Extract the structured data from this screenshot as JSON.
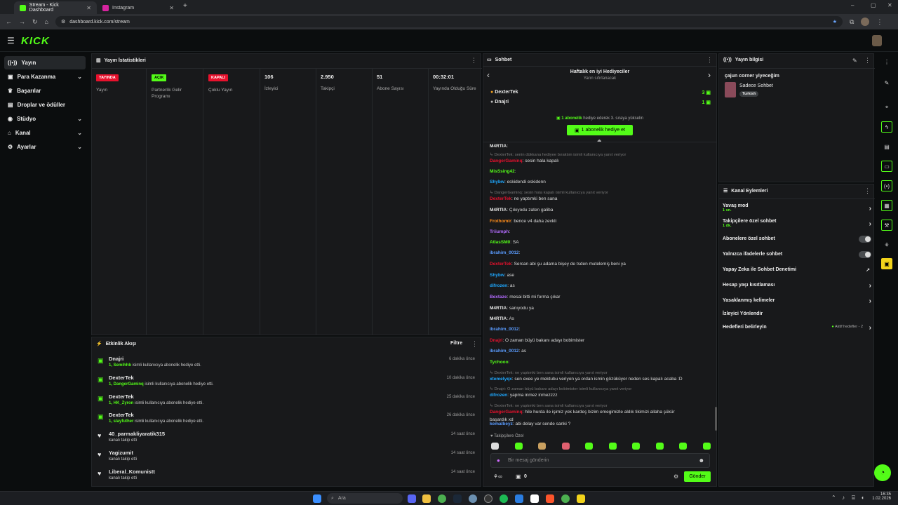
{
  "browser": {
    "tabs": [
      {
        "title": "Stream - Kick Dashboard",
        "active": true
      },
      {
        "title": "Instagram",
        "active": false
      }
    ],
    "url": "dashboard.kick.com/stream"
  },
  "brand": {
    "logo": "KICK",
    "accent": "#53fc18"
  },
  "sidebar": {
    "items": [
      {
        "label": "Yayın",
        "icon": "broadcast-icon",
        "active": true
      },
      {
        "label": "Para Kazanma",
        "icon": "money-icon",
        "expandable": true
      },
      {
        "label": "Başarılar",
        "icon": "trophy-icon"
      },
      {
        "label": "Droplar ve ödüller",
        "icon": "gift-icon"
      },
      {
        "label": "Stüdyo",
        "icon": "studio-icon",
        "expandable": true
      },
      {
        "label": "Kanal",
        "icon": "channel-icon",
        "expandable": true
      },
      {
        "label": "Ayarlar",
        "icon": "gear-icon",
        "expandable": true
      }
    ]
  },
  "stats": {
    "title": "Yayın İstatistikleri",
    "columns": [
      {
        "badge": "YAYINDA",
        "badge_color": "#e8112d",
        "label": "Yayın"
      },
      {
        "badge": "AÇIK",
        "badge_color": "#53fc18",
        "label": "Partnerlik Gelir Programı"
      },
      {
        "badge": "KAPALI",
        "badge_color": "#e8112d",
        "label": "Çoklu Yayın"
      },
      {
        "value": "106",
        "label": "İzleyici"
      },
      {
        "value": "2.950",
        "label": "Takipçi"
      },
      {
        "value": "51",
        "label": "Abone Sayısı"
      },
      {
        "value": "00:32:01",
        "label": "Yayında Olduğu Süre"
      }
    ]
  },
  "events": {
    "title": "Etkinlik Akışı",
    "filter_label": "Filtre",
    "items": [
      {
        "name": "Dnajri",
        "sub_user": "1, Semihhb",
        "sub_text": " isimli kullanıcıya abonelik hediye etti.",
        "time": "6 dakika önce",
        "kind": "gift"
      },
      {
        "name": "DexterTek",
        "sub_user": "1, DangerGaminq",
        "sub_text": " isimli kullanıcıya abonelik hediye etti.",
        "time": "10 dakika önce",
        "kind": "gift"
      },
      {
        "name": "DexterTek",
        "sub_user": "1, HK_Zyron",
        "sub_text": " isimli kullanıcıya abonelik hediye etti.",
        "time": "25 dakika önce",
        "kind": "gift"
      },
      {
        "name": "DexterTek",
        "sub_user": "1, slayfuther",
        "sub_text": " isimli kullanıcıya abonelik hediye etti.",
        "time": "26 dakika önce",
        "kind": "gift"
      },
      {
        "name": "40_parmakliyaratik315",
        "sub_user": "",
        "sub_text": "kanalı takip etti",
        "time": "14 saat önce",
        "kind": "follow"
      },
      {
        "name": "Yagizumit",
        "sub_user": "",
        "sub_text": "kanalı takip etti",
        "time": "14 saat önce",
        "kind": "follow"
      },
      {
        "name": "Liberal_Komunistt",
        "sub_user": "",
        "sub_text": "kanalı takip etti",
        "time": "14 saat önce",
        "kind": "follow"
      }
    ]
  },
  "chat": {
    "title": "Sohbet",
    "gifters_title": "Haftalık en iyi Hediyeciler",
    "gifters_sub": "Yarın sıfırlanacak",
    "gifters": [
      {
        "rank": "1",
        "name": "DexterTek",
        "count": "3"
      },
      {
        "rank": "2",
        "name": "Dnajri",
        "count": "1"
      }
    ],
    "promo_bold": "1 abonelik",
    "promo_text": " hediye ederek 3. sıraya yükselin",
    "promo_button": "1 abonelik hediye et",
    "messages": [
      {
        "reply": "",
        "user": "M4RTIA",
        "color": "#e8e8e8",
        "text": ":"
      },
      {
        "reply": "↳ DexterTek: senin dükkana hediyee bıraktım isimli kullanıcıya yanıt veriyor",
        "user": "",
        "color": "",
        "text": ""
      },
      {
        "reply": "",
        "user": "DangerGaminq",
        "color": "#e8112d",
        "text": ": sesin hala kapalı"
      },
      {
        "reply": "",
        "user": "MisSsing42",
        "color": "#53fc18",
        "text": ":"
      },
      {
        "reply": "",
        "user": "Shybw",
        "color": "#1ea8ff",
        "text": ": eskidendi eskidenn"
      },
      {
        "reply": "↳ DangerGaminq: sesin hala kapalı isimli kullanıcıya yanıt veriyor",
        "user": "",
        "color": "",
        "text": ""
      },
      {
        "reply": "",
        "user": "DexterTek",
        "color": "#e8112d",
        "text": ": ne yaptımki ben sana"
      },
      {
        "reply": "",
        "user": "M4RTIA",
        "color": "#e8e8e8",
        "text": ": Çıkıyodu zaten galiba"
      },
      {
        "reply": "",
        "user": "Frothomir",
        "color": "#ff8c1a",
        "text": ": bence v4 daha zevkli"
      },
      {
        "reply": "",
        "user": "Triiumph",
        "color": "#b36bff",
        "text": ":"
      },
      {
        "reply": "",
        "user": "AtlasSM0",
        "color": "#53fc18",
        "text": ": SA"
      },
      {
        "reply": "",
        "user": "ibrahim_0012",
        "color": "#5a9cff",
        "text": ":"
      },
      {
        "reply": "",
        "user": "DexterTek",
        "color": "#e8112d",
        "text": ": Sercan abi şu adama bişey de tsden mutelemiş beni ya"
      },
      {
        "reply": "",
        "user": "Shybw",
        "color": "#1ea8ff",
        "text": ": ase"
      },
      {
        "reply": "",
        "user": "difrozen",
        "color": "#1ea8ff",
        "text": ": as"
      },
      {
        "reply": "",
        "user": "Bextaze",
        "color": "#b36bff",
        "text": ": mesai bitti mi forma çıkar"
      },
      {
        "reply": "",
        "user": "M4RTIA",
        "color": "#e8e8e8",
        "text": ": sanıyodu ya"
      },
      {
        "reply": "",
        "user": "M4RTIA",
        "color": "#e8e8e8",
        "text": ": As"
      },
      {
        "reply": "",
        "user": "ibrahim_0012",
        "color": "#5a9cff",
        "text": ":"
      },
      {
        "reply": "",
        "user": "Dnajri",
        "color": "#e8112d",
        "text": ": O zaman büyü bakanı adayı bobimister"
      },
      {
        "reply": "",
        "user": "ibrahim_0012",
        "color": "#5a9cff",
        "text": ": as"
      },
      {
        "reply": "",
        "user": "Tychooo",
        "color": "#53fc18",
        "text": ":"
      },
      {
        "reply": "↳ DexterTek: ne yaptımki ben sana isimli kullanıcıya yanıt veriyor",
        "user": "",
        "color": "",
        "text": ""
      },
      {
        "reply": "",
        "user": "xtemelyqx",
        "color": "#1ea8ff",
        "text": ": sen exee ye mektubu veriyon ya ordan ismin gözüküyor neden ses kapalı acaba :D"
      },
      {
        "reply": "↳ Dnajri: O zaman büyü bakanı adayı bobimister isimli kullanıcıya yanıt veriyor",
        "user": "",
        "color": "",
        "text": ""
      },
      {
        "reply": "",
        "user": "difrozen",
        "color": "#1ea8ff",
        "text": ": yapma inmez inmezzzz"
      },
      {
        "reply": "↳ DexterTek: ne yaptımki ben sana isimli kullanıcıya yanıt veriyor",
        "user": "",
        "color": "",
        "text": ""
      },
      {
        "reply": "",
        "user": "DangerGaminq",
        "color": "#e8112d",
        "text": ": hile hurda ile işimiz yok kardeş bizim emegimizle aldık tikimizi allaha şükür"
      },
      {
        "reply": "",
        "user": "",
        "color": "",
        "text": "başardık xd"
      },
      {
        "reply": "",
        "user": "kemalbeyz",
        "color": "#5a9cff",
        "text": ": abi delay var sende sanki ?"
      }
    ],
    "emote_label": "Takipçilere Özel",
    "input_placeholder": "Bir mesaj gönderin",
    "counter": "0",
    "send_label": "Gönder"
  },
  "stream_info": {
    "title": "Yayın bilgisi",
    "stream_title": "çajun corner yiyeceğim",
    "category": "Sadece Sohbet",
    "language": "Turkish"
  },
  "channel_actions": {
    "title": "Kanal Eylemleri",
    "items": [
      {
        "label": "Yavaş mod",
        "sub": "1 sn.",
        "control": "arrow"
      },
      {
        "label": "Takipçilere özel sohbet",
        "sub": "1 dk.",
        "control": "arrow"
      },
      {
        "label": "Abonelere özel sohbet",
        "sub": "",
        "control": "toggle"
      },
      {
        "label": "Yalnızca ifadelerle sohbet",
        "sub": "",
        "control": "toggle"
      },
      {
        "label": "Yapay Zeka ile Sohbet Denetimi",
        "sub": "",
        "control": "external"
      },
      {
        "label": "Hesap yaşı kısıtlaması",
        "sub": "",
        "control": "arrow"
      },
      {
        "label": "Yasaklanmış kelimeler",
        "sub": "",
        "control": "arrow"
      },
      {
        "label": "İzleyici Yönlendir",
        "sub": "",
        "control": "none"
      },
      {
        "label": "Hedefleri belirleyin",
        "sub": "",
        "control": "arrow",
        "extra": "Aktif hedefler - 2"
      }
    ]
  },
  "taskbar": {
    "search_placeholder": "Ara",
    "time": "16:35",
    "date": "1.02.2026"
  }
}
